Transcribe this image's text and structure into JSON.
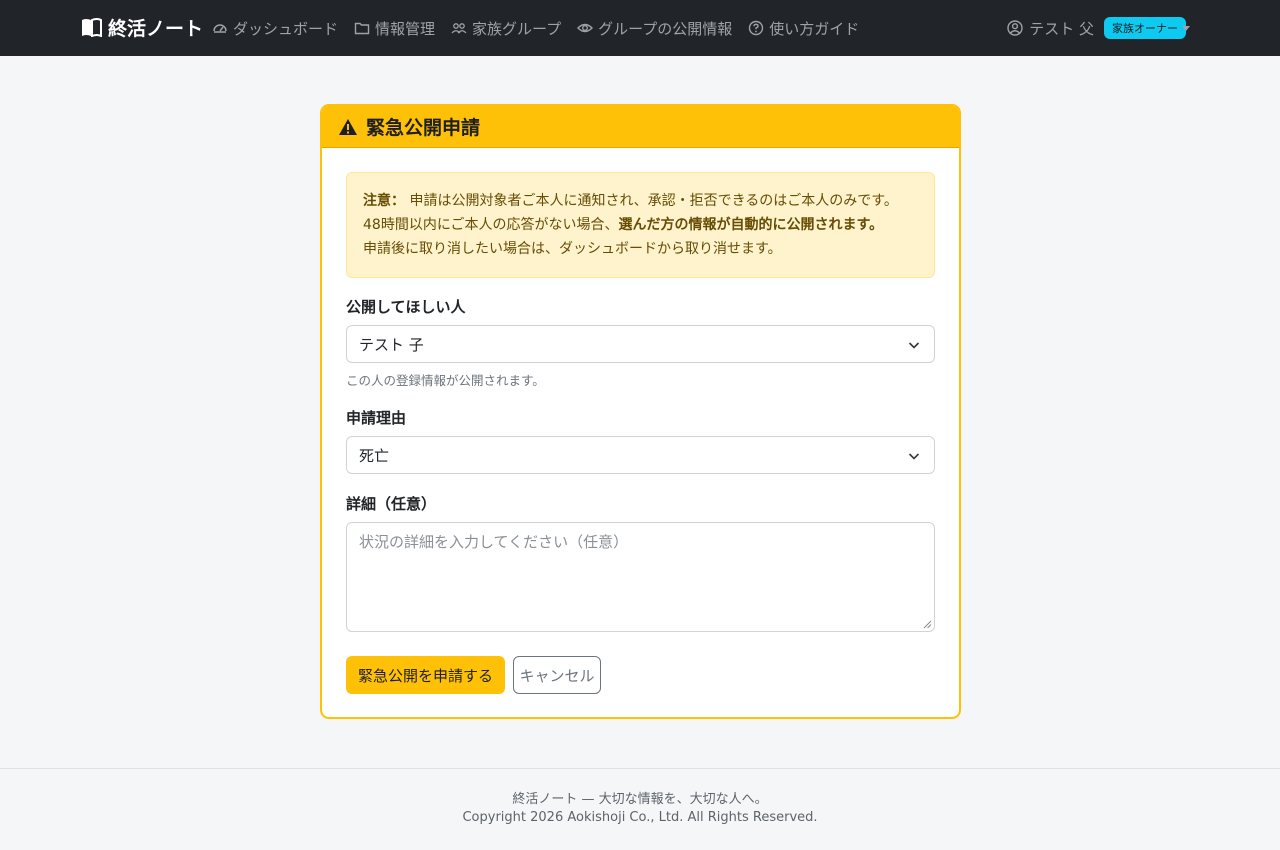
{
  "navbar": {
    "brand": "終活ノート",
    "links": [
      {
        "label": "ダッシュボード",
        "icon": "speedometer-icon"
      },
      {
        "label": "情報管理",
        "icon": "folder-icon"
      },
      {
        "label": "家族グループ",
        "icon": "people-icon"
      },
      {
        "label": "グループの公開情報",
        "icon": "eye-icon"
      },
      {
        "label": "使い方ガイド",
        "icon": "question-circle-icon"
      }
    ],
    "user_name": "テスト 父",
    "user_badge": "家族オーナー"
  },
  "card": {
    "title": "緊急公開申請",
    "alert": {
      "label": "注意：",
      "line1": "申請は公開対象者ご本人に通知され、承認・拒否できるのはご本人のみです。",
      "line2_prefix": "48時間以内にご本人の応答がない場合、",
      "line2_bold": "選んだ方の情報が自動的に公開されます。",
      "line3": "申請後に取り消したい場合は、ダッシュボードから取り消せます。"
    },
    "target_label": "公開してほしい人",
    "target_value": "テスト 子",
    "target_help": "この人の登録情報が公開されます。",
    "reason_label": "申請理由",
    "reason_value": "死亡",
    "detail_label": "詳細（任意）",
    "detail_placeholder": "状況の詳細を入力してください（任意）",
    "submit_label": "緊急公開を申請する",
    "cancel_label": "キャンセル"
  },
  "footer": {
    "line1": "終活ノート — 大切な情報を、大切な人へ。",
    "line2": "Copyright 2026 Aokishoji Co., Ltd. All Rights Reserved."
  },
  "colors": {
    "navbar_bg": "#212529",
    "warning": "#ffc107",
    "alert_bg": "#fff3cd",
    "badge_info": "#0dcaf0"
  }
}
